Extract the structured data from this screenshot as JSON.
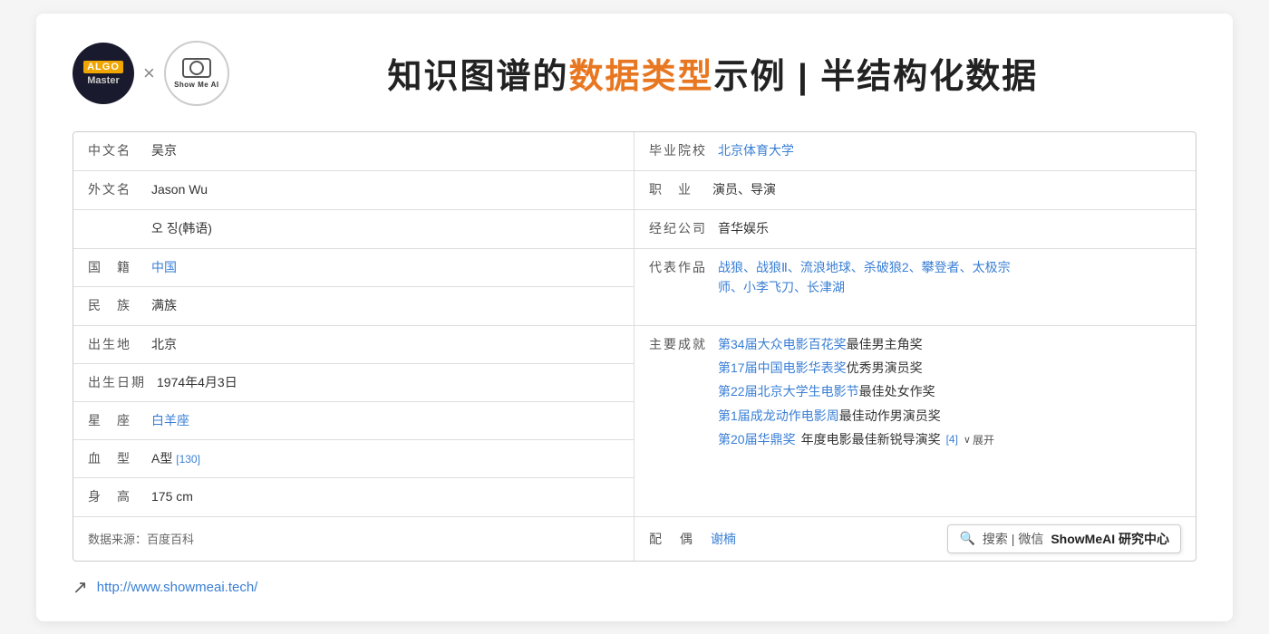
{
  "header": {
    "title_prefix": "知识图谱的",
    "title_highlight": "数据类型",
    "title_suffix": "示例 | 半结构化数据",
    "x_label": "×"
  },
  "logo": {
    "algo_top": "ALGO",
    "algo_bottom": "Master",
    "showme_text": "Show Me AI"
  },
  "table": {
    "rows": [
      {
        "left_label": "中文名",
        "left_value": "吴京",
        "left_type": "normal",
        "right_label": "毕业院校",
        "right_value": "北京体育大学",
        "right_type": "link"
      },
      {
        "left_label": "外文名",
        "left_value": "Jason Wu",
        "left_type": "normal",
        "right_label": "职　业",
        "right_value": "演员、导演",
        "right_type": "normal"
      },
      {
        "left_label": "",
        "left_value": "오 징(韩语)",
        "left_type": "normal",
        "right_label": "经纪公司",
        "right_value": "音华娱乐",
        "right_type": "normal"
      },
      {
        "left_label": "国　籍",
        "left_value": "中国",
        "left_type": "link",
        "right_label": "代表作品",
        "right_value": "战狼、战狼Ⅱ、流浪地球、杀破狼2、攀登者、太极宗师、小李飞刀、长津湖",
        "right_type": "link_multiline"
      },
      {
        "left_label": "民　族",
        "left_value": "满族",
        "left_type": "normal",
        "right_label": "",
        "right_value": "",
        "right_type": "empty"
      },
      {
        "left_label": "出生地",
        "left_value": "北京",
        "left_type": "normal",
        "right_label": "主要成就",
        "right_value_lines": [
          {
            "text": "第34届大众电影百花奖",
            "type": "link",
            "suffix_text": "最佳男主角奖",
            "suffix_type": "normal"
          },
          {
            "text": "第17届中国电影华表奖",
            "type": "link",
            "suffix_text": "优秀男演员奖",
            "suffix_type": "normal"
          },
          {
            "text": "第22届北京大学生电影节",
            "type": "link",
            "suffix_text": "最佳处女作奖",
            "suffix_type": "normal"
          }
        ],
        "right_type": "achieve"
      },
      {
        "left_label": "出生日期",
        "left_value": "1974年4月3日",
        "left_type": "normal",
        "right_label": "",
        "right_value": "",
        "right_type": "empty_continue"
      },
      {
        "left_label": "星　座",
        "left_value": "白羊座",
        "left_type": "link",
        "right_label": "",
        "right_value": "",
        "right_type": "empty_continue2"
      },
      {
        "left_label": "血　型",
        "left_value": "A型",
        "left_ref": "[130]",
        "left_type": "ref",
        "right_label": "",
        "right_value": "",
        "right_type": "achieve_last"
      },
      {
        "left_label": "身　高",
        "left_value": "175 cm",
        "left_type": "normal",
        "right_label": "",
        "right_value": "第20届华鼎奖年度电影最佳新锐导演奖",
        "right_ref": "[4]",
        "right_type": "achieve_expand"
      }
    ]
  },
  "bottom": {
    "source_label": "数据来源：百度百科",
    "partner_label": "配　偶",
    "partner_value": "谢楠",
    "search_icon": "🔍",
    "search_divider": "｜微信",
    "search_label": "ShowMeAI 研究中心",
    "expand_text": "展开"
  },
  "footer": {
    "url": "http://www.showmeai.tech/"
  },
  "achieve_lines": {
    "line1_link": "第34届大众电影百花奖",
    "line1_normal": "最佳男主角奖",
    "line2_link": "第17届中国电影华表奖",
    "line2_normal": "优秀男演员奖",
    "line3_link": "第22届北京大学生电影节",
    "line3_normal": "最佳处女作奖",
    "line4_link_pre": "第1届成龙动作电影周",
    "line4_normal": "最佳动作男演员奖",
    "line5_link_pre": "第20届华鼎奖",
    "line5_normal": "年度电影最佳新锐导演奖",
    "line5_ref": "[4]"
  }
}
